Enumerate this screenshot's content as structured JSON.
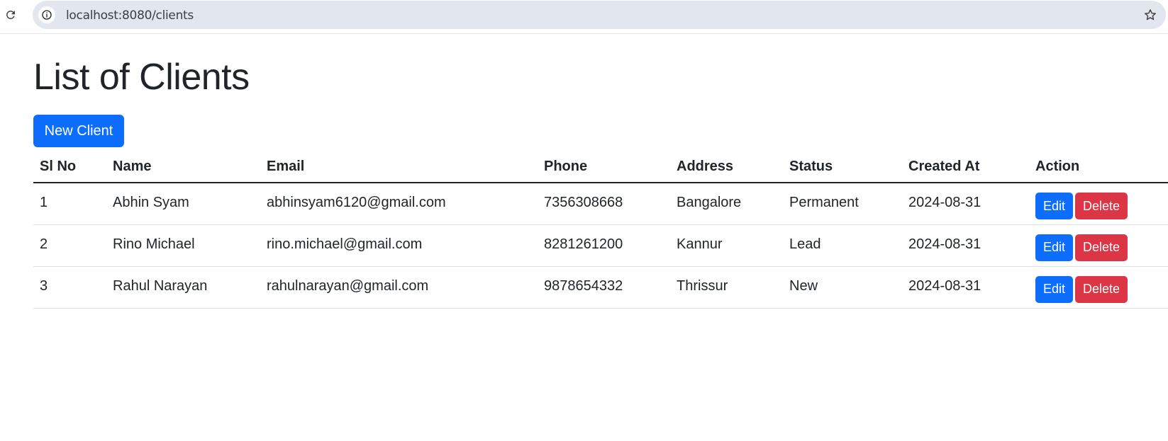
{
  "browser": {
    "url": "localhost:8080/clients"
  },
  "page": {
    "title": "List of Clients",
    "new_button_label": "New Client"
  },
  "table": {
    "headers": [
      "Sl No",
      "Name",
      "Email",
      "Phone",
      "Address",
      "Status",
      "Created At",
      "Action"
    ],
    "rows": [
      {
        "sl": "1",
        "name": "Abhin Syam",
        "email": "abhinsyam6120@gmail.com",
        "phone": "7356308668",
        "address": "Bangalore",
        "status": "Permanent",
        "created": "2024-08-31",
        "edit": "Edit",
        "delete": "Delete"
      },
      {
        "sl": "2",
        "name": "Rino Michael",
        "email": "rino.michael@gmail.com",
        "phone": "8281261200",
        "address": "Kannur",
        "status": "Lead",
        "created": "2024-08-31",
        "edit": "Edit",
        "delete": "Delete"
      },
      {
        "sl": "3",
        "name": "Rahul Narayan",
        "email": "rahulnarayan@gmail.com",
        "phone": "9878654332",
        "address": "Thrissur",
        "status": "New",
        "created": "2024-08-31",
        "edit": "Edit",
        "delete": "Delete"
      }
    ]
  },
  "colors": {
    "primary": "#0d6efd",
    "danger": "#dc3545"
  }
}
